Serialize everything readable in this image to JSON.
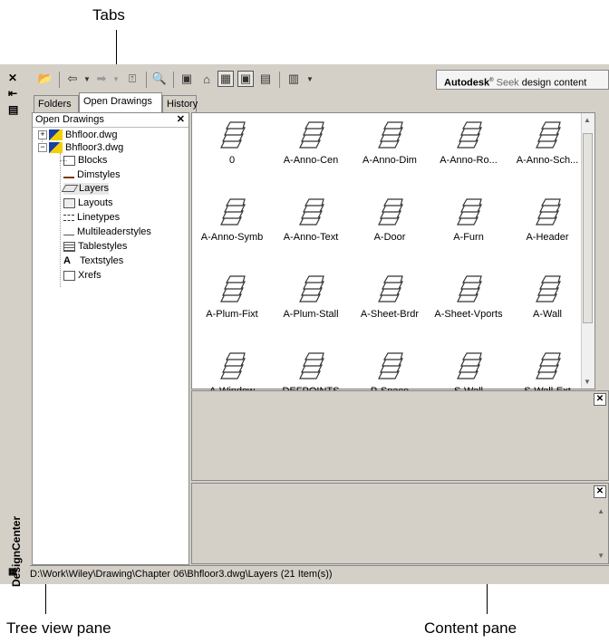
{
  "callouts": {
    "tabs": "Tabs",
    "tree_view_pane": "Tree view pane",
    "content_pane": "Content pane"
  },
  "window": {
    "title": "DesignCenter",
    "seek": {
      "brand": "Autodesk",
      "label": "Seek",
      "suffix": "design content"
    }
  },
  "tabs": [
    {
      "label": "Folders",
      "active": false
    },
    {
      "label": "Open Drawings",
      "active": true
    },
    {
      "label": "History",
      "active": false
    }
  ],
  "tree": {
    "header": "Open Drawings",
    "drawings": [
      "Bhfloor.dwg",
      "Bhfloor3.dwg"
    ],
    "items": [
      "Blocks",
      "Dimstyles",
      "Layers",
      "Layouts",
      "Linetypes",
      "Multileaderstyles",
      "Tablestyles",
      "Textstyles",
      "Xrefs"
    ],
    "selected": "Layers"
  },
  "content": {
    "layers": [
      "0",
      "A-Anno-Cen",
      "A-Anno-Dim",
      "A-Anno-Ro...",
      "A-Anno-Sch...",
      "A-Anno-Symb",
      "A-Anno-Text",
      "A-Door",
      "A-Furn",
      "A-Header",
      "A-Plum-Fixt",
      "A-Plum-Stall",
      "A-Sheet-Brdr",
      "A-Sheet-Vports",
      "A-Wall",
      "A-Window",
      "DEFPOINTS",
      "P-Space",
      "S-Wall",
      "S-Wall-Ext"
    ]
  },
  "status": {
    "path": "D:\\Work\\Wiley\\Drawing\\Chapter 06\\Bhfloor3.dwg\\Layers (21 Item(s))"
  },
  "colors": {
    "chrome": "#d4d0c8",
    "pane": "#ffffff"
  },
  "icons": [
    "close-icon",
    "auto-hide-icon",
    "properties-icon",
    "load-icon",
    "back-icon",
    "forward-icon",
    "up-icon",
    "search-icon",
    "favorites-icon",
    "home-icon",
    "tree-toggle-icon",
    "preview-icon",
    "description-icon",
    "views-icon",
    "layer-icon"
  ]
}
